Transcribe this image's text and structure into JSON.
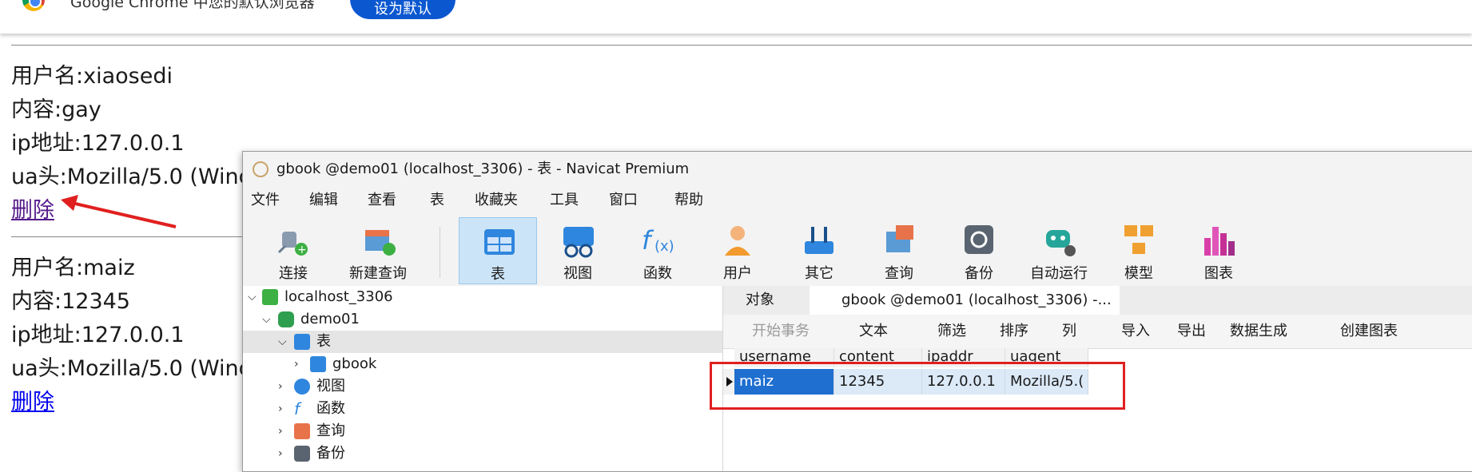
{
  "banner": {
    "text": "Google Chrome 中您的默认浏览器",
    "button": "设为默认"
  },
  "entries": [
    {
      "username": "用户名:xiaosedi",
      "content": "内容:gay",
      "ip": "ip地址:127.0.0.1",
      "ua": "ua头:Mozilla/5.0 (Wind",
      "delete": "删除"
    },
    {
      "username": "用户名:maiz",
      "content": "内容:12345",
      "ip": "ip地址:127.0.0.1",
      "ua": "ua头:Mozilla/5.0 (Wind",
      "delete": "删除"
    }
  ],
  "navicat": {
    "title": "gbook @demo01 (localhost_3306) - 表 - Navicat Premium",
    "menu": [
      "文件",
      "编辑",
      "查看",
      "表",
      "收藏夹",
      "工具",
      "窗口",
      "帮助"
    ],
    "toolbar": [
      "连接",
      "新建查询",
      "表",
      "视图",
      "函数",
      "用户",
      "其它",
      "查询",
      "备份",
      "自动运行",
      "模型",
      "图表"
    ],
    "tree": {
      "connection": "localhost_3306",
      "database": "demo01",
      "tables_node": "表",
      "table": "gbook",
      "views_node": "视图",
      "functions_node": "函数",
      "queries_node": "查询",
      "backup_node": "备份"
    },
    "tabs": [
      "对象",
      "gbook @demo01 (localhost_3306) -..."
    ],
    "subtoolbar": [
      "开始事务",
      "文本",
      "筛选",
      "排序",
      "列",
      "导入",
      "导出",
      "数据生成",
      "创建图表"
    ],
    "grid": {
      "headers": [
        "username",
        "content",
        "ipaddr",
        "uagent"
      ],
      "row": [
        "maiz",
        "12345",
        "127.0.0.1",
        "Mozilla/5.("
      ]
    }
  },
  "colors": {
    "annotation_red": "#e0201f",
    "selection_blue": "#1f6fd0",
    "link": "#0000ee"
  }
}
